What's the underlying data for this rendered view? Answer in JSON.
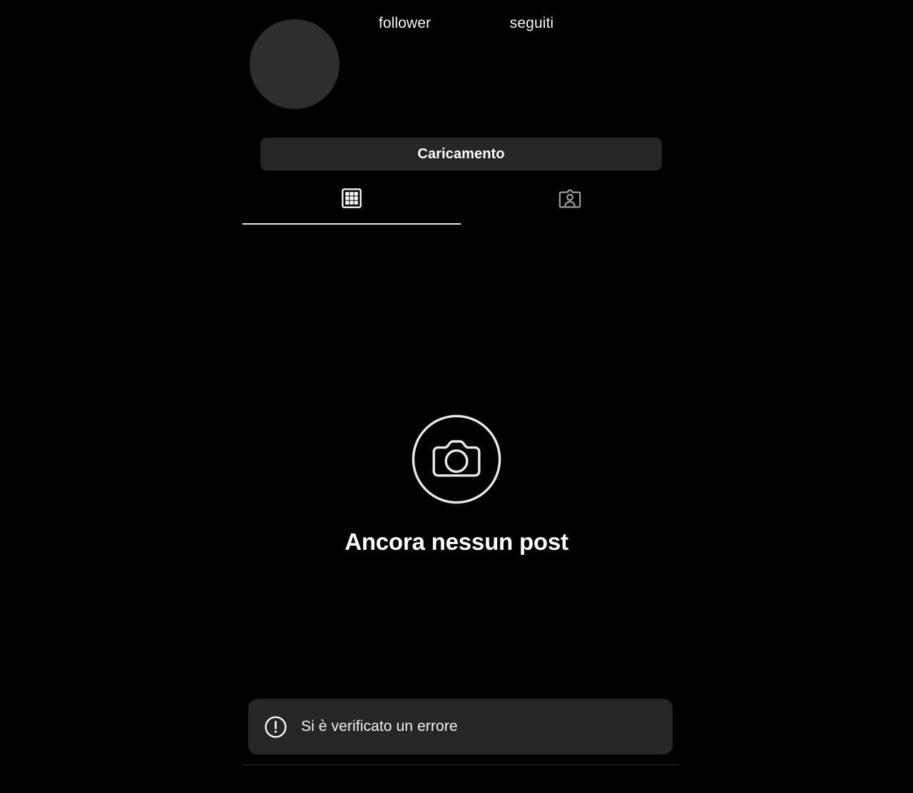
{
  "app": {
    "background_color": "#000000",
    "surface_color": "#262626",
    "text_color": "#ffffff"
  },
  "profile": {
    "avatar_icon": "avatar-placeholder",
    "stats": [
      {
        "key": "followers",
        "label": "follower",
        "value": ""
      },
      {
        "key": "following",
        "label": "seguiti",
        "value": ""
      }
    ],
    "action_button_label": "Caricamento"
  },
  "tabs": [
    {
      "key": "posts",
      "icon": "grid-icon",
      "active": true
    },
    {
      "key": "tagged",
      "icon": "tagged-person-icon",
      "active": false
    }
  ],
  "empty_state": {
    "icon": "camera-circle-icon",
    "title": "Ancora nessun post"
  },
  "toast": {
    "icon": "exclamation-circle-icon",
    "message": "Si è verificato un errore"
  }
}
